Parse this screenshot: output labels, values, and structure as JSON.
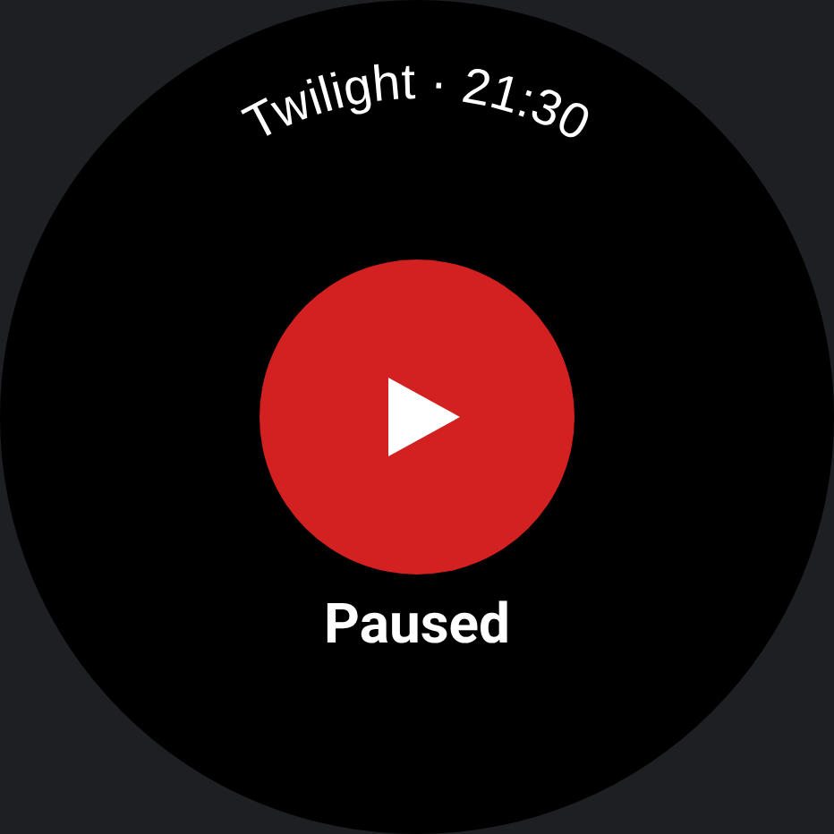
{
  "header": {
    "title": "Twilight · 21:30"
  },
  "player": {
    "playing": false,
    "status": "Paused"
  }
}
